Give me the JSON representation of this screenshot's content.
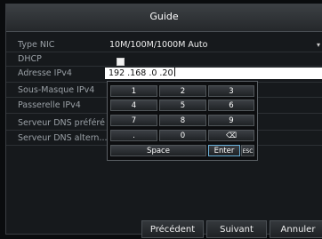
{
  "window": {
    "title": "Guide"
  },
  "form": {
    "nic_type": {
      "label": "Type NIC",
      "value": "10M/100M/1000M Auto"
    },
    "dhcp": {
      "label": "DHCP",
      "checked": false
    },
    "ipv4_address": {
      "label": "Adresse IPv4",
      "value": "192 .168 .0    .20"
    },
    "subnet_mask": {
      "label": "Sous-Masque IPv4",
      "value": ""
    },
    "gateway": {
      "label": "Passerelle  IPv4",
      "value": ""
    },
    "preferred_dns": {
      "label": "Serveur DNS préféré",
      "value": ""
    },
    "alternate_dns": {
      "label": "Serveur DNS altern...",
      "value": ""
    }
  },
  "keypad": {
    "keys": [
      "1",
      "2",
      "3",
      "4",
      "5",
      "6",
      "7",
      "8",
      "9",
      ".",
      "0",
      "⌫"
    ],
    "space_label": "Space",
    "enter_label": "Enter",
    "esc_label": "ESC"
  },
  "footer": {
    "previous_label": "Précédent",
    "next_label": "Suivant",
    "cancel_label": "Annuler"
  },
  "icons": {
    "dropdown": "chevron-down-icon",
    "backspace": "backspace-icon",
    "checkbox": "checkbox-icon"
  },
  "colors": {
    "title_gradient_top": "#3c4044",
    "panel_bg": "#16191c",
    "enter_highlight": "#6ab0d8"
  }
}
